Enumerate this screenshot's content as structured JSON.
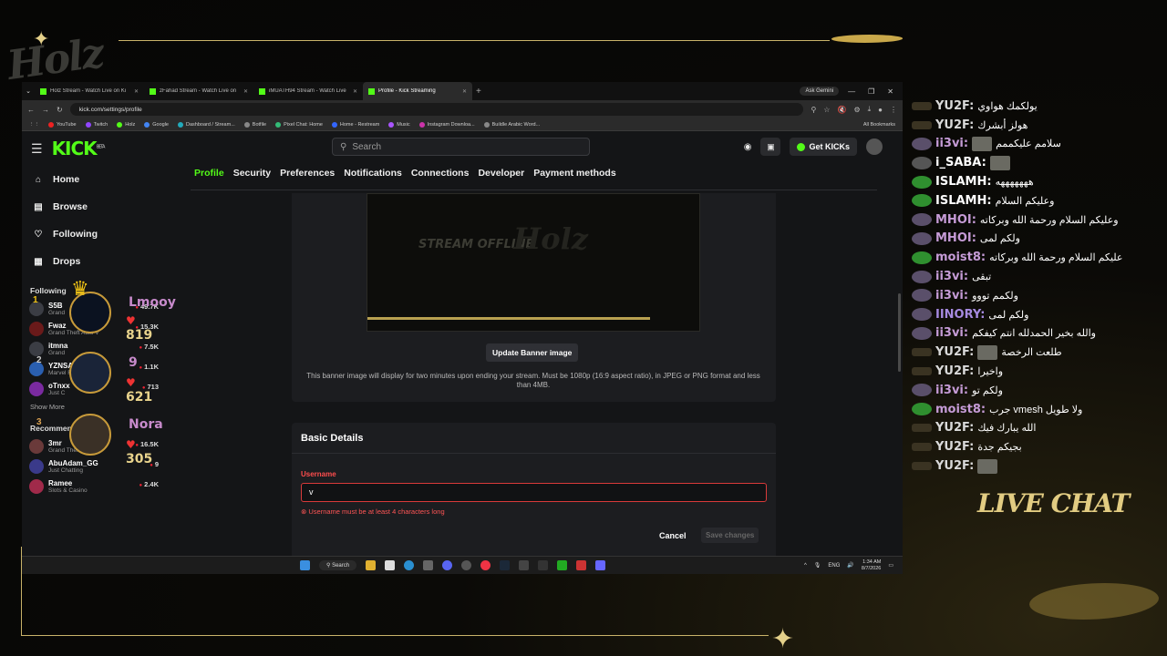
{
  "overlay": {
    "logo": "Holz",
    "live_chat_label": "LIVE CHAT",
    "badges": [
      {
        "rank": "1",
        "name": "Lmooy",
        "value": "819",
        "name_color": "#c78acb"
      },
      {
        "rank": "2",
        "name": "9",
        "value": "621",
        "name_color": "#c78acb"
      },
      {
        "rank": "3",
        "name": "Nora",
        "value": "305",
        "name_color": "#c78acb"
      }
    ]
  },
  "browser": {
    "tabs": [
      {
        "label": "Holz Stream - Watch Live on Ki"
      },
      {
        "label": "zFahad Stream - Watch Live on"
      },
      {
        "label": "iMUATH94 Stream - Watch Live"
      },
      {
        "label": "Profile - Kick Streaming"
      }
    ],
    "ask_gemini": "Ask Gemini",
    "url": "kick.com/settings/profile",
    "bookmarks": [
      "YouTube",
      "Twitch",
      "Holz",
      "Google",
      "Dashboard / Stream...",
      "Botfile",
      "Pixel Chat: Home",
      "Home - Restream",
      "Music",
      "Instagram Downloa...",
      "Buildle Arabic Word..."
    ],
    "all_bookmarks": "All Bookmarks"
  },
  "kick": {
    "logo": "KICK",
    "beta": "BETA",
    "search_placeholder": "Search",
    "get_kicks": "Get KICKs",
    "nav": [
      {
        "label": "Home",
        "icon": "home-icon"
      },
      {
        "label": "Browse",
        "icon": "browse-icon"
      },
      {
        "label": "Following",
        "icon": "heart-icon"
      },
      {
        "label": "Drops",
        "icon": "drops-icon"
      }
    ],
    "following_title": "Following",
    "following": [
      {
        "name": "S5B",
        "game": "Grand",
        "viewers": "49.7K"
      },
      {
        "name": "Fwaz",
        "game": "Grand Theft Auto V",
        "viewers": "15.3K"
      },
      {
        "name": "itmna",
        "game": "Grand",
        "viewers": "7.5K"
      },
      {
        "name": "YZNSA",
        "game": "Marvel Rivals",
        "viewers": "1.1K"
      },
      {
        "name": "oTnxx",
        "game": "Just C",
        "viewers": "713"
      }
    ],
    "show_more": "Show More",
    "recommended_title": "Recommended",
    "recommended": [
      {
        "name": "3mr",
        "game": "Grand Theft Auto V",
        "viewers": "16.5K"
      },
      {
        "name": "AbuAdam_GG",
        "game": "Just Chatting",
        "viewers": "9"
      },
      {
        "name": "Ramee",
        "game": "Slots & Casino",
        "viewers": "2.4K"
      }
    ],
    "settings_tabs": [
      "Profile",
      "Security",
      "Preferences",
      "Notifications",
      "Connections",
      "Developer",
      "Payment methods"
    ],
    "banner": {
      "offline_text": "STREAM OFFLINE",
      "update_button": "Update Banner image",
      "note": "This banner image will display for two minutes upon ending your stream. Must be 1080p (16:9 aspect ratio), in JPEG or PNG format and less than 4MB."
    },
    "basic_details": {
      "title": "Basic Details",
      "username_label": "Username",
      "username_value": "v",
      "error": "Username must be at least 4 characters long",
      "cancel": "Cancel",
      "save": "Save changes"
    }
  },
  "taskbar": {
    "search": "Search",
    "lang": "ENG",
    "time": "1:34 AM",
    "date": "8/7/2026"
  },
  "chat": [
    {
      "user": "YU2F:",
      "text": "يولكمك هواوي",
      "color": "#d9d9d9",
      "icon": "g"
    },
    {
      "user": "YU2F:",
      "text": "هولز أبشرك",
      "color": "#d9d9d9",
      "icon": "g"
    },
    {
      "user": "ii3vi:",
      "text": "سلامم عليكممم",
      "color": "#c59bd6",
      "icon": "a",
      "emote": true
    },
    {
      "user": "i_SABA:",
      "text": "",
      "color": "#ffffff",
      "icon": "r",
      "emote": true
    },
    {
      "user": "ISLAMH:",
      "text": "هههههههه",
      "color": "#ffffff",
      "icon": "b"
    },
    {
      "user": "ISLAMH:",
      "text": "وعليكم السلام",
      "color": "#ffffff",
      "icon": "b"
    },
    {
      "user": "MHOI:",
      "text": "وعليكم السلام ورحمة الله وبركاته",
      "color": "#c59bd6",
      "icon": "a"
    },
    {
      "user": "MHOI:",
      "text": "ولكم لمى",
      "color": "#c59bd6",
      "icon": "a"
    },
    {
      "user": "moist8:",
      "text": "عليكم السلام ورحمة الله وبركاته",
      "color": "#c59bd6",
      "icon": "b"
    },
    {
      "user": "ii3vi:",
      "text": "تبقى",
      "color": "#c59bd6",
      "icon": "a"
    },
    {
      "user": "ii3vi:",
      "text": "ولكمم تووو",
      "color": "#c59bd6",
      "icon": "a"
    },
    {
      "user": "IINORY:",
      "text": "ولكم لمى",
      "color": "#a68ae0",
      "icon": "a"
    },
    {
      "user": "ii3vi:",
      "text": "والله بخير الحمدلله انتم كيفكم",
      "color": "#c59bd6",
      "icon": "a"
    },
    {
      "user": "YU2F:",
      "text": "طلعت الرخصة",
      "color": "#d9d9d9",
      "icon": "g",
      "emote": true
    },
    {
      "user": "YU2F:",
      "text": "واخيرا",
      "color": "#d9d9d9",
      "icon": "g"
    },
    {
      "user": "ii3vi:",
      "text": "ولكم تو",
      "color": "#c59bd6",
      "icon": "a"
    },
    {
      "user": "moist8:",
      "text": "جرب vmesh ولا طويل",
      "color": "#c59bd6",
      "icon": "b"
    },
    {
      "user": "YU2F:",
      "text": "الله يبارك فيك",
      "color": "#d9d9d9",
      "icon": "g"
    },
    {
      "user": "YU2F:",
      "text": "بجيكم جدة",
      "color": "#d9d9d9",
      "icon": "g"
    },
    {
      "user": "YU2F:",
      "text": "",
      "color": "#d9d9d9",
      "icon": "g",
      "emote": true
    }
  ]
}
